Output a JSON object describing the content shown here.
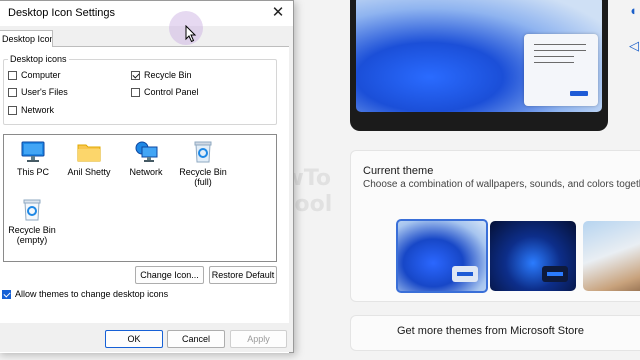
{
  "dialog": {
    "title": "Desktop Icon Settings",
    "close_glyph": "✕",
    "tab": "Desktop Icons",
    "group_label": "Desktop icons",
    "checkboxes": [
      {
        "label": "Computer",
        "checked": false
      },
      {
        "label": "Recycle Bin",
        "checked": true
      },
      {
        "label": "User's Files",
        "checked": false
      },
      {
        "label": "Control Panel",
        "checked": false
      },
      {
        "label": "Network",
        "checked": false
      }
    ],
    "icons": [
      {
        "label": "This PC",
        "icon": "monitor-icon"
      },
      {
        "label": "Anil Shetty",
        "icon": "folder-icon"
      },
      {
        "label": "Network",
        "icon": "network-icon"
      },
      {
        "label": "Recycle Bin\n(full)",
        "icon": "recycle-bin-full-icon"
      },
      {
        "label": "Recycle Bin\n(empty)",
        "icon": "recycle-bin-empty-icon"
      }
    ],
    "change_icon_label": "Change Icon...",
    "restore_default_label": "Restore Default",
    "allow_themes_label": "Allow themes to change desktop icons",
    "allow_themes_checked": true,
    "ok_label": "OK",
    "cancel_label": "Cancel",
    "apply_label": "Apply"
  },
  "settings": {
    "current_theme_title": "Current theme",
    "current_theme_desc": "Choose a combination of wallpapers, sounds, and colors together",
    "store_link": "Get more themes from Microsoft Store"
  },
  "watermark": "My HowTo School",
  "colors": {
    "accent": "#1660d6",
    "selected_theme_border": "#3a6fd8"
  }
}
